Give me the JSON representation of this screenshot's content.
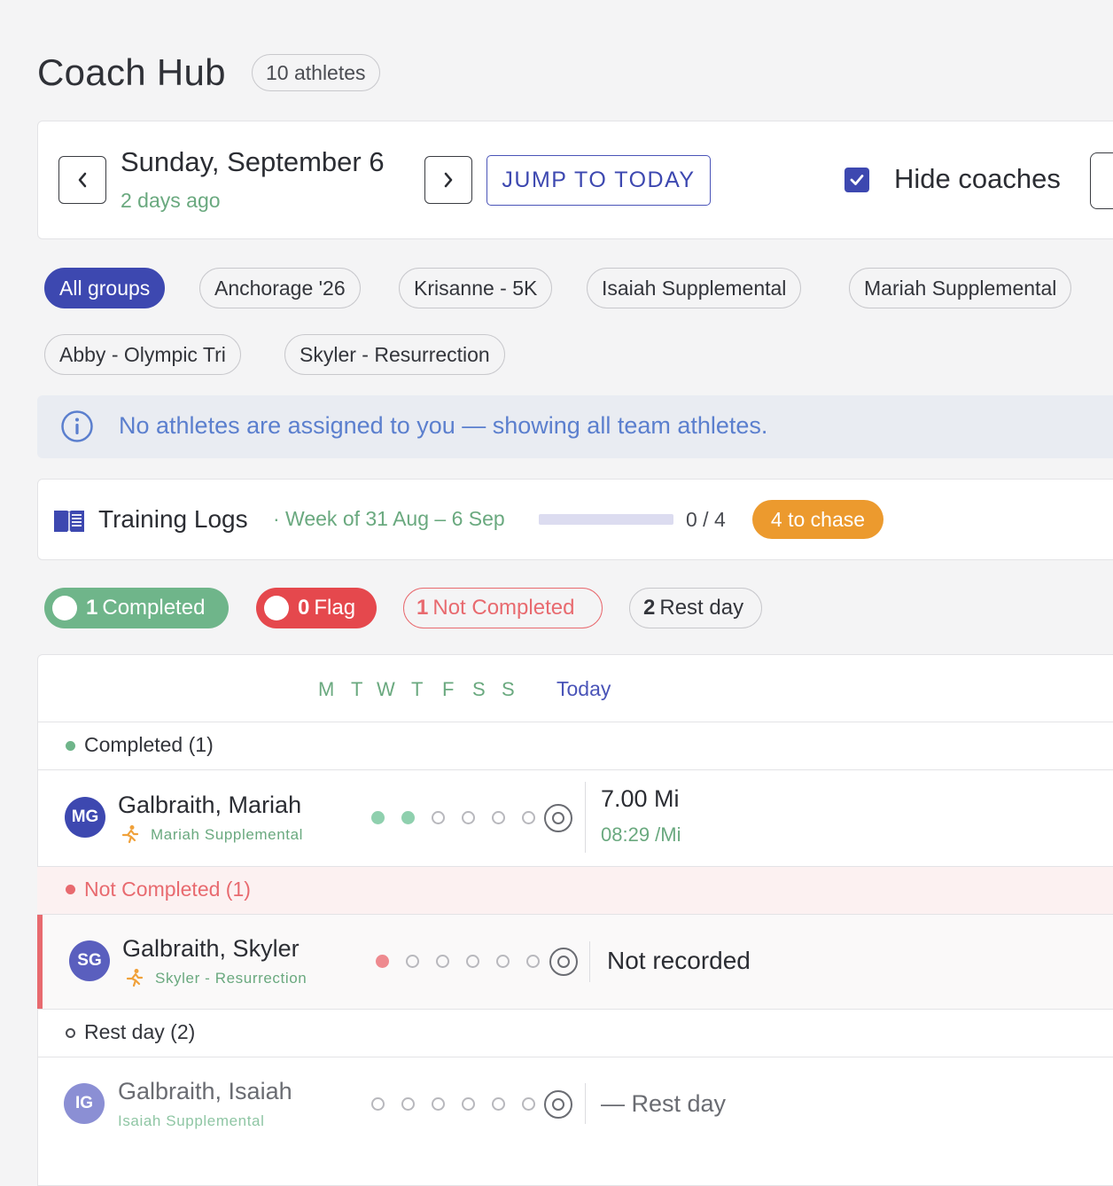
{
  "header": {
    "title": "Coach Hub",
    "athletes_count": "10 athletes"
  },
  "date_nav": {
    "date": "Sunday, September 6",
    "relative": "2 days ago",
    "jump_label": "JUMP TO TODAY",
    "hide_coaches_label": "Hide coaches",
    "hide_coaches_checked": true
  },
  "groups": [
    {
      "label": "All groups",
      "active": true
    },
    {
      "label": "Anchorage '26",
      "active": false
    },
    {
      "label": "Krisanne - 5K",
      "active": false
    },
    {
      "label": "Isaiah Supplemental",
      "active": false
    },
    {
      "label": "Mariah Supplemental",
      "active": false
    },
    {
      "label": "Abby - Olympic Tri",
      "active": false
    },
    {
      "label": "Skyler - Resurrection",
      "active": false
    }
  ],
  "info": {
    "message": "No athletes are assigned to you — showing all team athletes.",
    "icon": "info-icon"
  },
  "training_logs": {
    "title": "Training Logs",
    "week": "· Week of 31 Aug – 6 Sep",
    "ratio": "0 / 4",
    "progress_fraction": 0,
    "chase_label": "4 to chase"
  },
  "status_filters": {
    "completed": {
      "count": "1",
      "label": "Completed",
      "color": "#6fb58a"
    },
    "flag": {
      "count": "0",
      "label": "Flag",
      "color": "#e5484d"
    },
    "not_completed": {
      "count": "1",
      "label": "Not Completed",
      "color": "#e86a6f"
    },
    "rest_day": {
      "count": "2",
      "label": "Rest day"
    }
  },
  "table": {
    "days": [
      "M",
      "T",
      "W",
      "T",
      "F",
      "S",
      "S"
    ],
    "today_label": "Today",
    "sections": [
      {
        "label": "Completed (1)",
        "athletes": [
          {
            "initials": "MG",
            "name": "Galbraith, Mariah",
            "group": "Mariah Supplemental",
            "week": [
              "done",
              "done",
              "empty",
              "empty",
              "empty",
              "empty"
            ],
            "main": "7.00 Mi",
            "sub": "08:29 /Mi"
          }
        ]
      },
      {
        "label": "Not Completed (1)",
        "athletes": [
          {
            "initials": "SG",
            "name": "Galbraith, Skyler",
            "group": "Skyler - Resurrection",
            "week": [
              "miss",
              "empty",
              "empty",
              "empty",
              "empty",
              "empty"
            ],
            "main": "Not recorded"
          }
        ]
      },
      {
        "label": "Rest day (2)",
        "athletes": [
          {
            "initials": "IG",
            "name": "Galbraith, Isaiah",
            "group": "Isaiah Supplemental",
            "week": [
              "empty",
              "empty",
              "empty",
              "empty",
              "empty",
              "empty"
            ],
            "main": "— Rest day"
          }
        ]
      }
    ]
  }
}
